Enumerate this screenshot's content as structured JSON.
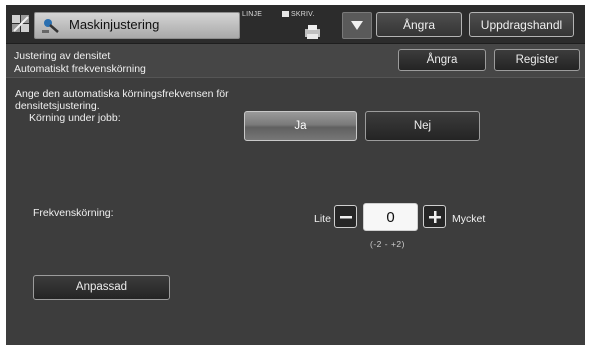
{
  "header": {
    "title": "Maskinjustering",
    "status_linje": "LINJE",
    "status_skriv": "SKRIV.",
    "undo_label": "Ångra",
    "job_button_label": "Uppdragshandl"
  },
  "subheader": {
    "line1": "Justering av densitet",
    "line2": "Automatiskt frekvenskörning",
    "undo_label": "Ångra",
    "register_label": "Register"
  },
  "body": {
    "instruction_line1": "Ange den automatiska körningsfrekvensen för",
    "instruction_line2": "densitetsjustering.",
    "during_job_label": "Körning under jobb:",
    "option_yes": "Ja",
    "option_no": "Nej",
    "selected_option": "Ja",
    "frequency_label": "Frekvenskörning:",
    "low_label": "Lite",
    "high_label": "Mycket",
    "frequency_value": "0",
    "range_hint": "(-2 - +2)",
    "custom_button_label": "Anpassad"
  },
  "icons": {
    "home": "home-icon",
    "tool": "machine-adjust-icon",
    "printer": "printer-icon",
    "dropdown": "triangle-down-icon",
    "minus": "minus-icon",
    "plus": "plus-icon"
  },
  "colors": {
    "background": "#3d3d3d",
    "selected_button": "#8a8a8a",
    "value_box": "#f7f7f7"
  }
}
